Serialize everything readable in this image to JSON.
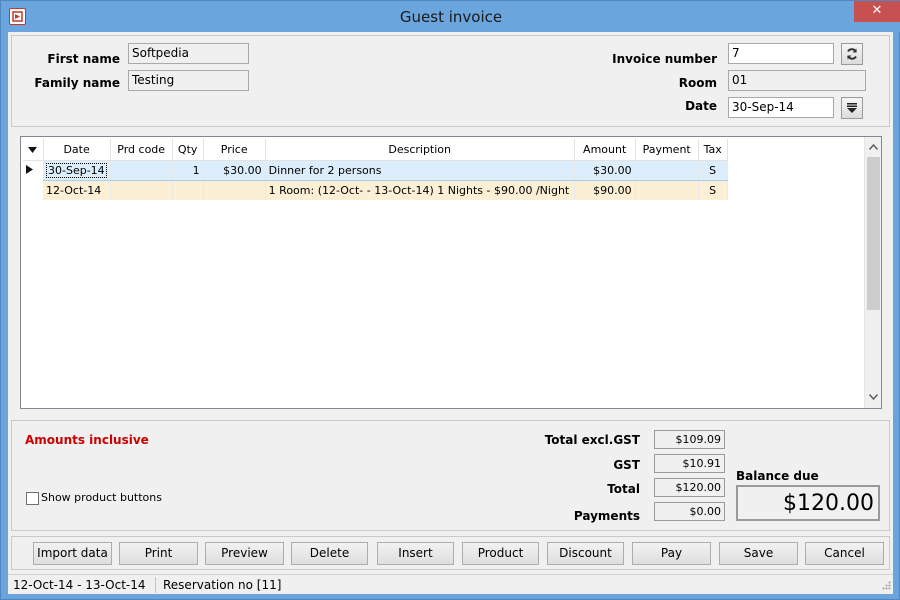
{
  "window": {
    "title": "Guest invoice",
    "close_glyph": "✕"
  },
  "guest": {
    "first_name_label": "First name",
    "first_name_value": "Softpedia",
    "family_name_label": "Family name",
    "family_name_value": "Testing"
  },
  "invoice": {
    "number_label": "Invoice number",
    "number_value": "7",
    "room_label": "Room",
    "room_value": "01",
    "date_label": "Date",
    "date_value": "30-Sep-14"
  },
  "grid": {
    "columns": [
      "Date",
      "Prd code",
      "Qty",
      "Price",
      "Description",
      "Amount",
      "Payment",
      "Tax"
    ],
    "rows": [
      {
        "date": "30-Sep-14",
        "prd_code": "",
        "qty": "1",
        "price": "$30.00",
        "description": "Dinner for 2 persons",
        "amount": "$30.00",
        "payment": "",
        "tax": "S"
      },
      {
        "date": "12-Oct-14",
        "prd_code": "",
        "qty": "",
        "price": "",
        "description": "1 Room: (12-Oct- - 13-Oct-14) 1 Nights - $90.00 /Night",
        "amount": "$90.00",
        "payment": "",
        "tax": "S"
      }
    ]
  },
  "totals": {
    "amounts_note": "Amounts  inclusive",
    "show_product_buttons_label": "Show product buttons",
    "total_excl_label": "Total excl.GST",
    "total_excl_value": "$109.09",
    "gst_label": "GST",
    "gst_value": "$10.91",
    "total_label": "Total",
    "total_value": "$120.00",
    "payments_label": "Payments",
    "payments_value": "$0.00",
    "balance_due_label": "Balance due",
    "balance_due_value": "$120.00"
  },
  "buttons": {
    "import_data": "Import data",
    "print": "Print",
    "preview": "Preview",
    "delete": "Delete",
    "insert": "Insert",
    "product": "Product",
    "discount": "Discount",
    "pay": "Pay",
    "save": "Save",
    "cancel": "Cancel"
  },
  "status": {
    "dates": "12-Oct-14 - 13-Oct-14",
    "reservation": "Reservation no [11]"
  },
  "colors": {
    "titlebar": "#6aa5de",
    "close_button": "#c75050",
    "accent_red": "#cc0000",
    "selected_row": "#dceefc",
    "room_row": "#fbf0d6"
  },
  "icons": {
    "refresh": "refresh-icon",
    "dropdown": "dropdown-icon",
    "row_pointer": "row-pointer-icon",
    "menu": "column-menu-icon"
  }
}
